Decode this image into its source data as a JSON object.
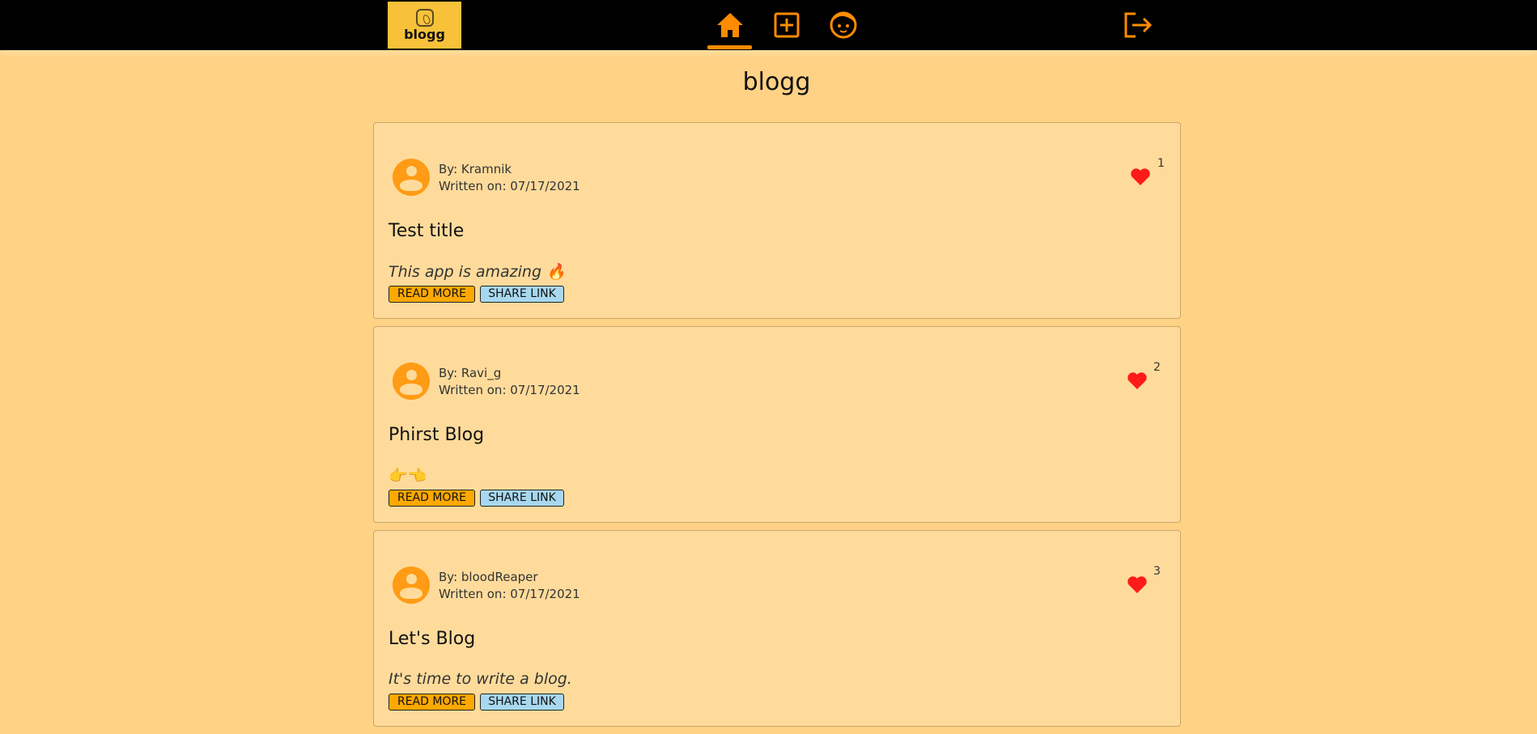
{
  "header": {
    "logo_text": "blogg",
    "nav": [
      {
        "name": "home",
        "icon": "home-icon",
        "active": true
      },
      {
        "name": "new-post",
        "icon": "plus-square-icon",
        "active": false
      },
      {
        "name": "profile",
        "icon": "face-icon",
        "active": false
      }
    ],
    "logout_icon": "logout-icon",
    "accent_color": "#ff8c00"
  },
  "page": {
    "title": "blogg"
  },
  "posts": [
    {
      "author": "By: Kramnik",
      "date": "Written on: 07/17/2021",
      "title": "Test title",
      "excerpt": "This app is amazing 🔥",
      "likes": "1",
      "read_more": "READ MORE",
      "share": "SHARE LINK"
    },
    {
      "author": "By: Ravi_g",
      "date": "Written on: 07/17/2021",
      "title": "Phirst Blog",
      "excerpt": "👉👈",
      "likes": "2",
      "read_more": "READ MORE",
      "share": "SHARE LINK"
    },
    {
      "author": "By: bloodReaper",
      "date": "Written on: 07/17/2021",
      "title": "Let's Blog",
      "excerpt": "It's time to write a blog.",
      "likes": "3",
      "read_more": "READ MORE",
      "share": "SHARE LINK"
    }
  ]
}
